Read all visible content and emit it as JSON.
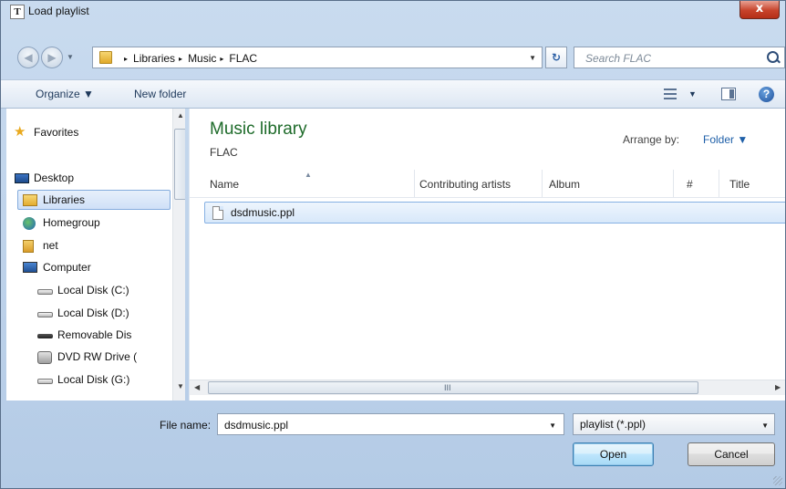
{
  "window": {
    "title": "Load playlist",
    "close_glyph": "x",
    "app_icon_glyph": "T"
  },
  "nav_buttons": {
    "back_glyph": "◀",
    "forward_glyph": "▶",
    "dropdown_glyph": "▼"
  },
  "address": {
    "crumbs": [
      "Libraries",
      "Music",
      "FLAC"
    ],
    "separator": "▸",
    "dropdown_glyph": "▼",
    "refresh_glyph": "↻"
  },
  "search": {
    "placeholder": "Search FLAC"
  },
  "toolbar": {
    "organize_label": "Organize ▼",
    "new_folder_label": "New folder",
    "views_dd": "▼",
    "help_glyph": "?"
  },
  "sidebar": {
    "items": [
      {
        "label": "Favorites",
        "icon": "star-icon"
      },
      {
        "label": "Desktop",
        "icon": "desktop-icon"
      },
      {
        "label": "Libraries",
        "icon": "libraries-icon",
        "selected": true
      },
      {
        "label": "Homegroup",
        "icon": "homegroup-icon"
      },
      {
        "label": "net",
        "icon": "user-folder-icon"
      },
      {
        "label": "Computer",
        "icon": "computer-icon"
      },
      {
        "label": "Local Disk (C:)",
        "icon": "drive-icon"
      },
      {
        "label": "Local Disk (D:)",
        "icon": "drive-icon"
      },
      {
        "label": "Removable Dis",
        "icon": "removable-drive-icon"
      },
      {
        "label": "DVD RW Drive (",
        "icon": "dvd-drive-icon"
      },
      {
        "label": "Local Disk (G:)",
        "icon": "drive-icon"
      }
    ]
  },
  "library": {
    "title": "Music library",
    "subtitle": "FLAC",
    "arrange_label": "Arrange by:",
    "arrange_value": "Folder ▼"
  },
  "columns": [
    "Name",
    "Contributing artists",
    "Album",
    "#",
    "Title"
  ],
  "files": [
    {
      "name": "dsdmusic.ppl",
      "icon": "file-icon",
      "selected": true
    }
  ],
  "scroll": {
    "left": "◀",
    "right": "▶",
    "up": "▲",
    "down": "▼",
    "grip": "III"
  },
  "bottom": {
    "file_name_label": "File name:",
    "file_name_value": "dsdmusic.ppl",
    "file_type_value": "playlist (*.ppl)",
    "open_label": "Open",
    "cancel_label": "Cancel"
  },
  "colors": {
    "library_title": "#1e6b2a",
    "selection": "#d8e8fa",
    "close_button": "#c7432b"
  }
}
